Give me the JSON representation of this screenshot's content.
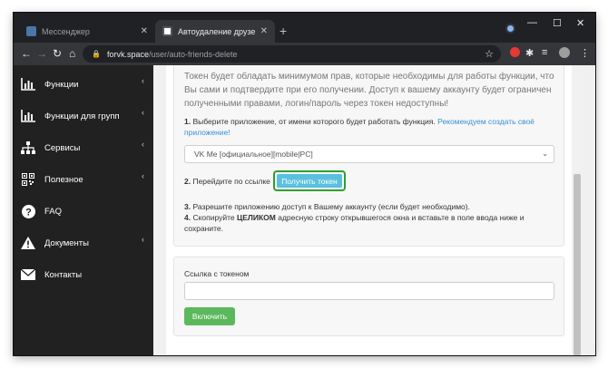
{
  "browser": {
    "tabs": [
      {
        "title": "Мессенджер",
        "favicon_color": "#4a76a8"
      },
      {
        "title": "Автоудаление друзей с FORVK",
        "favicon_color": "#ffffff"
      }
    ],
    "new_tab_symbol": "+",
    "close_symbol": "✕",
    "window_controls": [
      "—",
      "☐",
      "✕"
    ],
    "nav": {
      "back": "←",
      "forward": "→",
      "reload": "↻",
      "home": "⌂"
    },
    "address": {
      "host": "forvk.space",
      "path": "/user/auto-friends-delete"
    },
    "toolbar_icons": [
      "star-icon",
      "extension-badge-icon",
      "puzzle-icon",
      "media-icon",
      "profile-avatar",
      "menu-icon"
    ]
  },
  "sidebar": {
    "items": [
      {
        "label": "Функции",
        "icon": "bar-chart-icon",
        "has_submenu": true
      },
      {
        "label": "Функции для групп",
        "icon": "bar-chart-icon",
        "has_submenu": true
      },
      {
        "label": "Сервисы",
        "icon": "sitemap-icon",
        "has_submenu": true
      },
      {
        "label": "Полезное",
        "icon": "qrcode-icon",
        "has_submenu": true
      },
      {
        "label": "FAQ",
        "icon": "question-circle-icon",
        "has_submenu": false
      },
      {
        "label": "Документы",
        "icon": "warning-icon",
        "has_submenu": true
      },
      {
        "label": "Контакты",
        "icon": "envelope-icon",
        "has_submenu": false
      }
    ]
  },
  "content": {
    "info_text": "Токен будет обладать минимумом прав, которые необходимы для работы функции, что Вы сами и подтвердите при его получении. Доступ к вашему аккаунту будет ограничен полученными правами, логин/пароль через токен недоступны!",
    "step1_num": "1.",
    "step1_text": "Выберите приложение, от имени которого будет работать функция.",
    "step1_link": "Рекомендуем создать своё приложение!",
    "select_value": "VK Me [официальное][mobile|PC]",
    "step2_num": "2.",
    "step2_text": "Перейдите по ссылке",
    "token_button": "Получить токен",
    "step3_num": "3.",
    "step3_text": "Разрешите приложению доступ к Вашему аккаунту (если будет необходимо).",
    "step4_num": "4.",
    "step4_pre": "Скопируйте",
    "step4_bold": "ЦЕЛИКОМ",
    "step4_post": "адресную строку открывшегося окна и вставьте в поле ввода ниже и сохраните.",
    "token_field_label": "Ссылка с токеном",
    "token_field_value": "",
    "enable_button": "Включить"
  },
  "colors": {
    "accent_green": "#5cb85c",
    "info_blue": "#5bc0de",
    "highlight": "#2ea02e",
    "link": "#3a8fd0"
  }
}
